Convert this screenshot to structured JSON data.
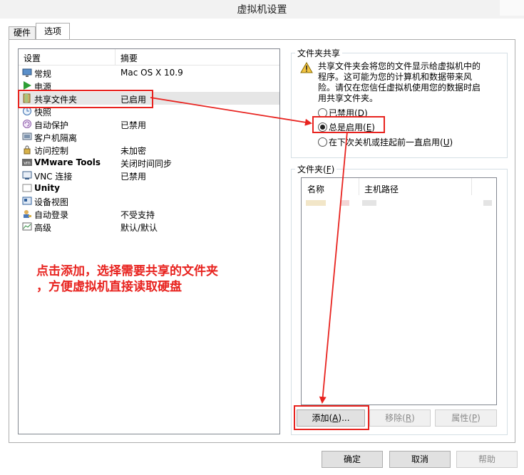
{
  "window": {
    "title": "虚拟机设置"
  },
  "tabs": [
    {
      "label": "硬件"
    },
    {
      "label": "选项"
    }
  ],
  "settings_table": {
    "col_setting": "设置",
    "col_summary": "摘要",
    "rows": [
      {
        "name": "常规",
        "summary": "Mac OS X 10.9",
        "icon": "monitor-icon"
      },
      {
        "name": "电源",
        "summary": "",
        "icon": "play-icon"
      },
      {
        "name": "共享文件夹",
        "summary": "已启用",
        "icon": "folder-share-icon"
      },
      {
        "name": "快照",
        "summary": "",
        "icon": "snapshot-icon"
      },
      {
        "name": "自动保护",
        "summary": "已禁用",
        "icon": "autoprotect-icon"
      },
      {
        "name": "客户机隔离",
        "summary": "",
        "icon": "isolation-icon"
      },
      {
        "name": "访问控制",
        "summary": "未加密",
        "icon": "lock-icon"
      },
      {
        "name": "VMware Tools",
        "summary": "关闭时间同步",
        "icon": "vmware-tools-icon"
      },
      {
        "name": "VNC 连接",
        "summary": "已禁用",
        "icon": "vnc-icon"
      },
      {
        "name": "Unity",
        "summary": "",
        "icon": "unity-icon"
      },
      {
        "name": "设备视图",
        "summary": "",
        "icon": "device-view-icon"
      },
      {
        "name": "自动登录",
        "summary": "不受支持",
        "icon": "autologin-icon"
      },
      {
        "name": "高级",
        "summary": "默认/默认",
        "icon": "advanced-icon"
      }
    ]
  },
  "folder_sharing": {
    "title": "文件夹共享",
    "warning": "共享文件夹会将您的文件显示给虚拟机中的程序。这可能为您的计算机和数据带来风险。请仅在您信任虚拟机使用您的数据时启用共享文件夹。",
    "options": [
      {
        "label": "已禁用(",
        "key": "D",
        "suffix": ")",
        "selected": false
      },
      {
        "label": "总是启用(",
        "key": "E",
        "suffix": ")",
        "selected": true
      },
      {
        "label": "在下次关机或挂起前一直启用(",
        "key": "U",
        "suffix": ")",
        "selected": false
      }
    ]
  },
  "folders": {
    "title_prefix": "文件夹(",
    "title_key": "F",
    "title_suffix": ")",
    "col_name": "名称",
    "col_host_path": "主机路径",
    "add_button": {
      "pre": "添加(",
      "key": "A",
      "post": ")..."
    },
    "remove_button": {
      "pre": "移除(",
      "key": "R",
      "post": ")"
    },
    "properties_button": {
      "pre": "属性(",
      "key": "P",
      "post": ")"
    }
  },
  "footer": {
    "ok": "确定",
    "cancel": "取消",
    "help": "帮助"
  },
  "annotation": {
    "line1": "点击添加，选择需要共享的文件夹",
    "line2": "，方便虚拟机直接读取硬盘"
  },
  "colors": {
    "annotation_red": "#e8231f",
    "selection_gray": "#e6e6e6"
  }
}
